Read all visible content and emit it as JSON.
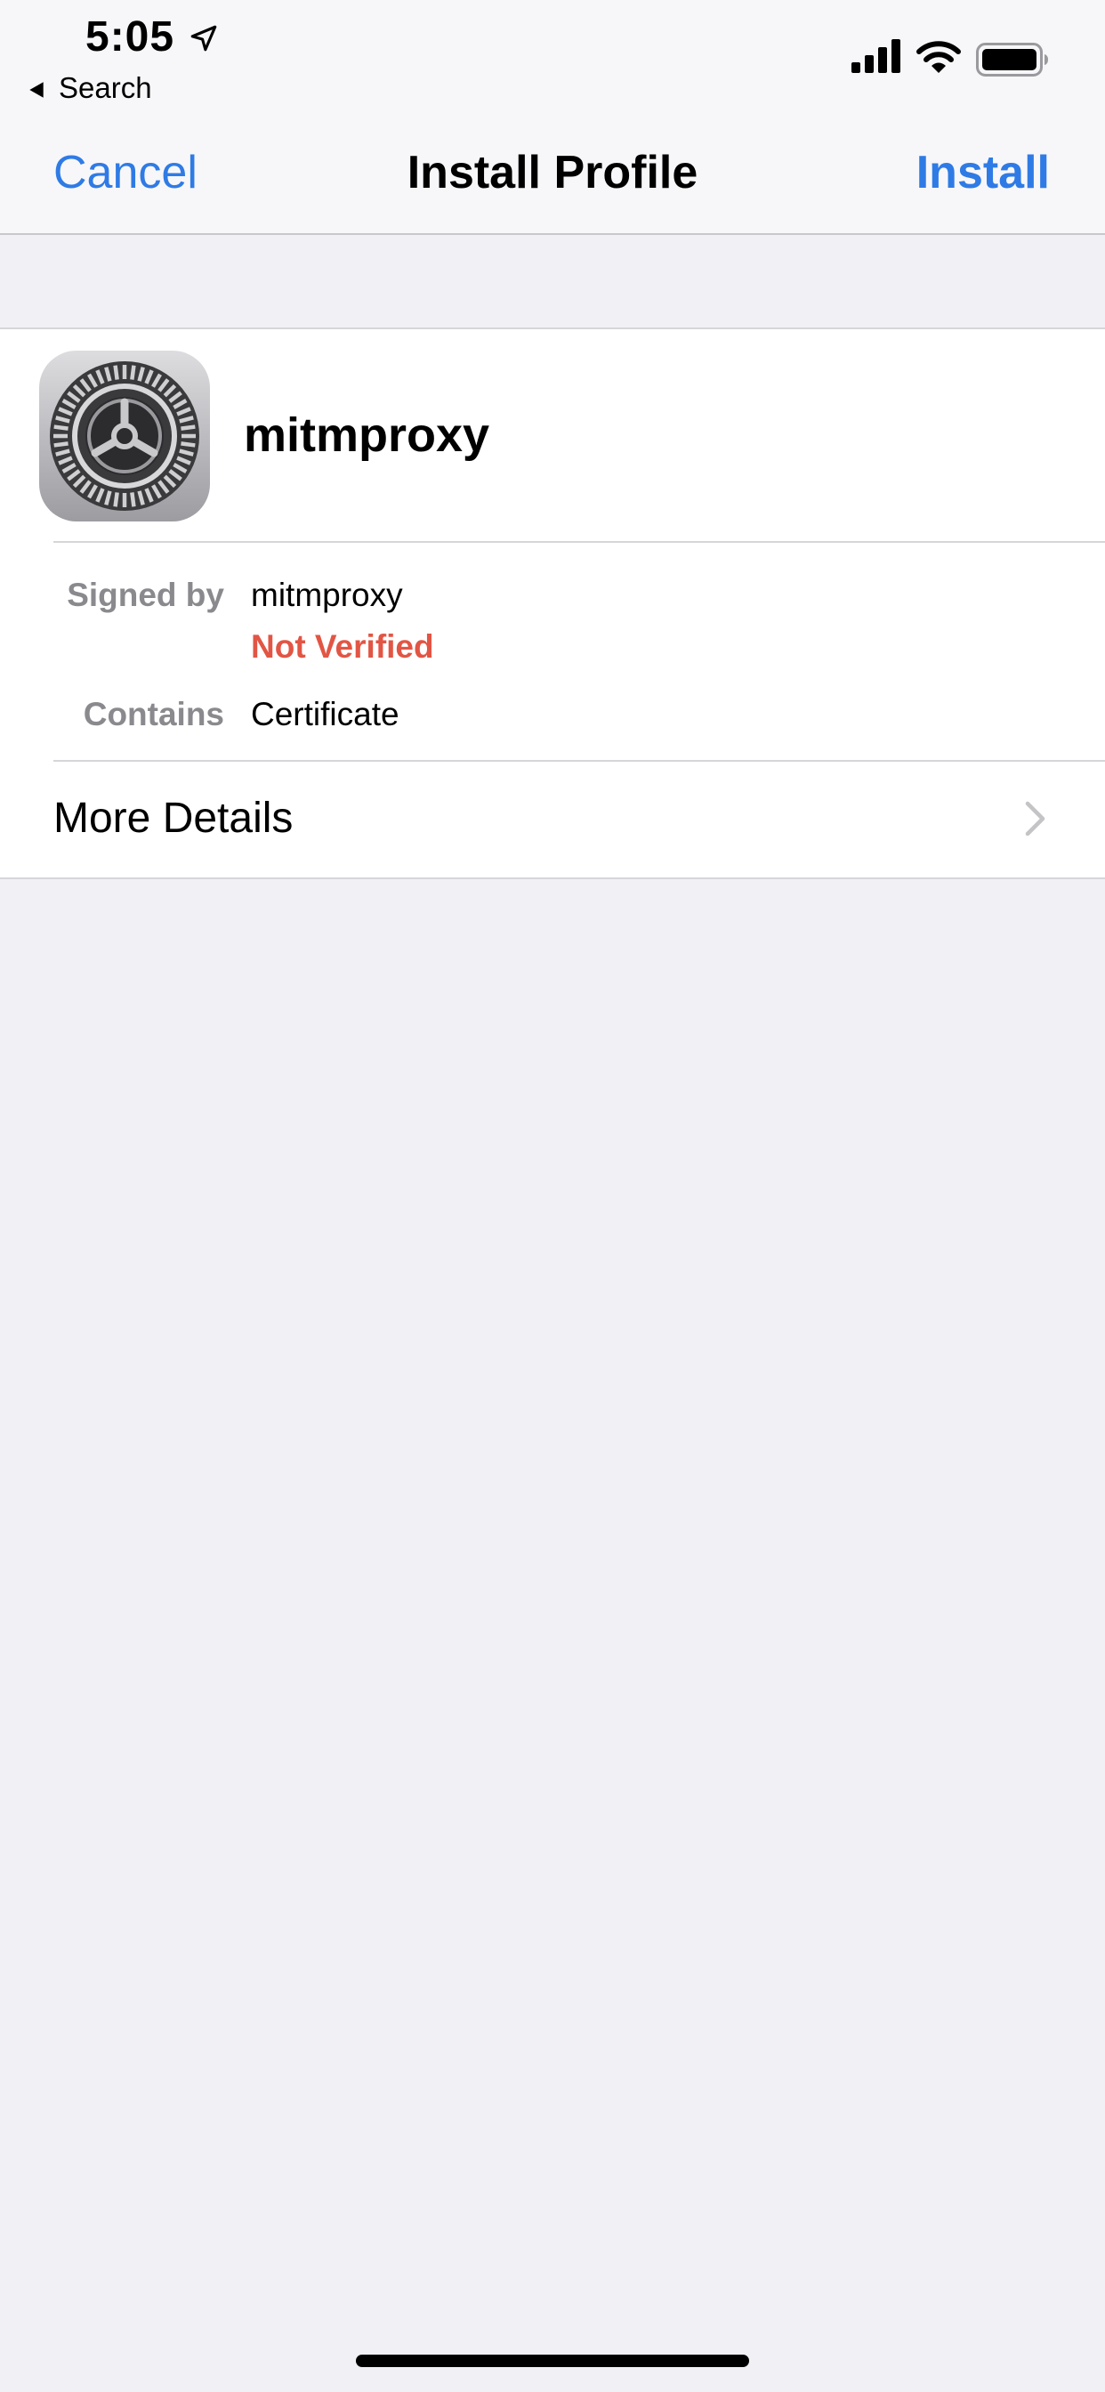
{
  "status_bar": {
    "time": "5:05",
    "back_label": "Search"
  },
  "nav": {
    "cancel_label": "Cancel",
    "title": "Install Profile",
    "install_label": "Install"
  },
  "profile": {
    "name": "mitmproxy",
    "icon": "settings-gear-icon",
    "signed_by_label": "Signed by",
    "signed_by_value": "mitmproxy",
    "verification_status": "Not Verified",
    "contains_label": "Contains",
    "contains_value": "Certificate",
    "more_details_label": "More Details"
  },
  "colors": {
    "accent": "#2F7BE5",
    "warning": "#E25544",
    "background": "#F0F0F5"
  }
}
